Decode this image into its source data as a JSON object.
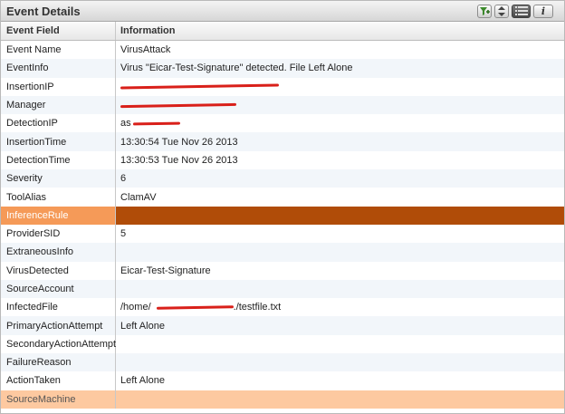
{
  "panel": {
    "title": "Event Details"
  },
  "toolbar": {
    "buttons": [
      {
        "icon": "filter-add-icon"
      },
      {
        "icon": "sort-up-down-icon"
      },
      {
        "icon": "list-view-icon"
      },
      {
        "icon": "info-icon",
        "label": "i"
      }
    ]
  },
  "table": {
    "headers": {
      "field": "Event Field",
      "info": "Information"
    },
    "rows": [
      {
        "field": "Event Name",
        "value": "VirusAttack"
      },
      {
        "field": "EventInfo",
        "value": "Virus \"Eicar-Test-Signature\" detected.  File Left Alone"
      },
      {
        "field": "InsertionIP",
        "value": ""
      },
      {
        "field": "Manager",
        "value": ""
      },
      {
        "field": "DetectionIP",
        "value": "as"
      },
      {
        "field": "InsertionTime",
        "value": "13:30:54 Tue Nov 26 2013"
      },
      {
        "field": "DetectionTime",
        "value": "13:30:53 Tue Nov 26 2013"
      },
      {
        "field": "Severity",
        "value": "6"
      },
      {
        "field": "ToolAlias",
        "value": "ClamAV"
      },
      {
        "field": "InferenceRule",
        "value": ""
      },
      {
        "field": "ProviderSID",
        "value": "5"
      },
      {
        "field": "ExtraneousInfo",
        "value": ""
      },
      {
        "field": "VirusDetected",
        "value": "Eicar-Test-Signature"
      },
      {
        "field": "SourceAccount",
        "value": ""
      },
      {
        "field": "InfectedFile",
        "value": "/home/",
        "value_suffix": "./testfile.txt"
      },
      {
        "field": "PrimaryActionAttempt",
        "value": "Left Alone"
      },
      {
        "field": "SecondaryActionAttempt",
        "value": ""
      },
      {
        "field": "FailureReason",
        "value": ""
      },
      {
        "field": "ActionTaken",
        "value": "Left Alone"
      },
      {
        "field": "SourceMachine",
        "value": ""
      }
    ]
  },
  "colors": {
    "selected_row": "#f59a58",
    "selected_cell": "#b04c08",
    "highlight_row": "#fdc9a0",
    "redaction": "#d9201a"
  }
}
